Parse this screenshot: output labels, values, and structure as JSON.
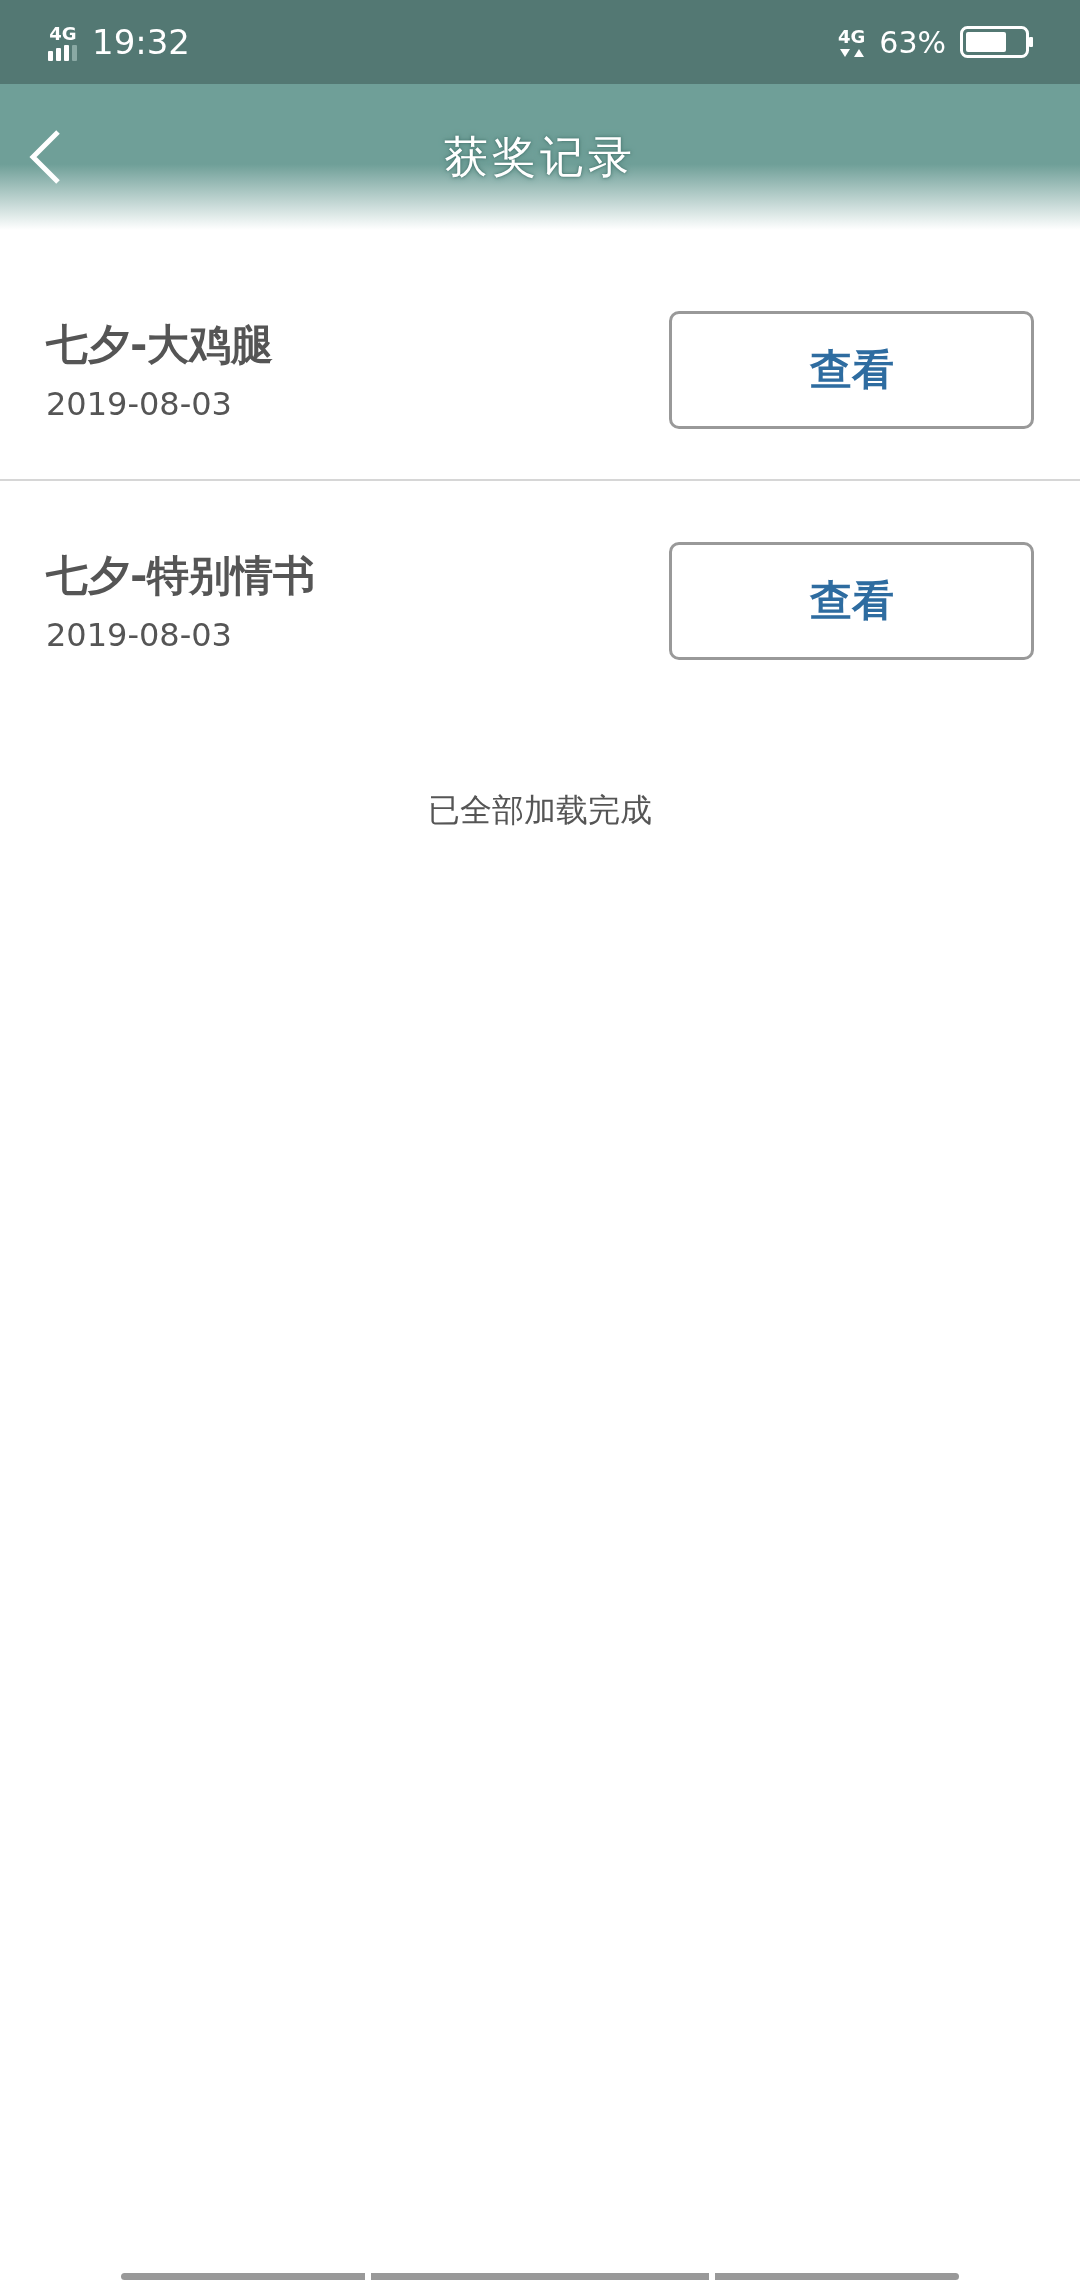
{
  "status_bar": {
    "network": "4G",
    "time": "19:32",
    "data_network": "4G",
    "battery": "63%"
  },
  "header": {
    "title": "获奖记录"
  },
  "records": [
    {
      "name": "七夕-大鸡腿",
      "date": "2019-08-03",
      "button": "查看"
    },
    {
      "name": "七夕-特别情书",
      "date": "2019-08-03",
      "button": "查看"
    }
  ],
  "footer": "已全部加载完成"
}
